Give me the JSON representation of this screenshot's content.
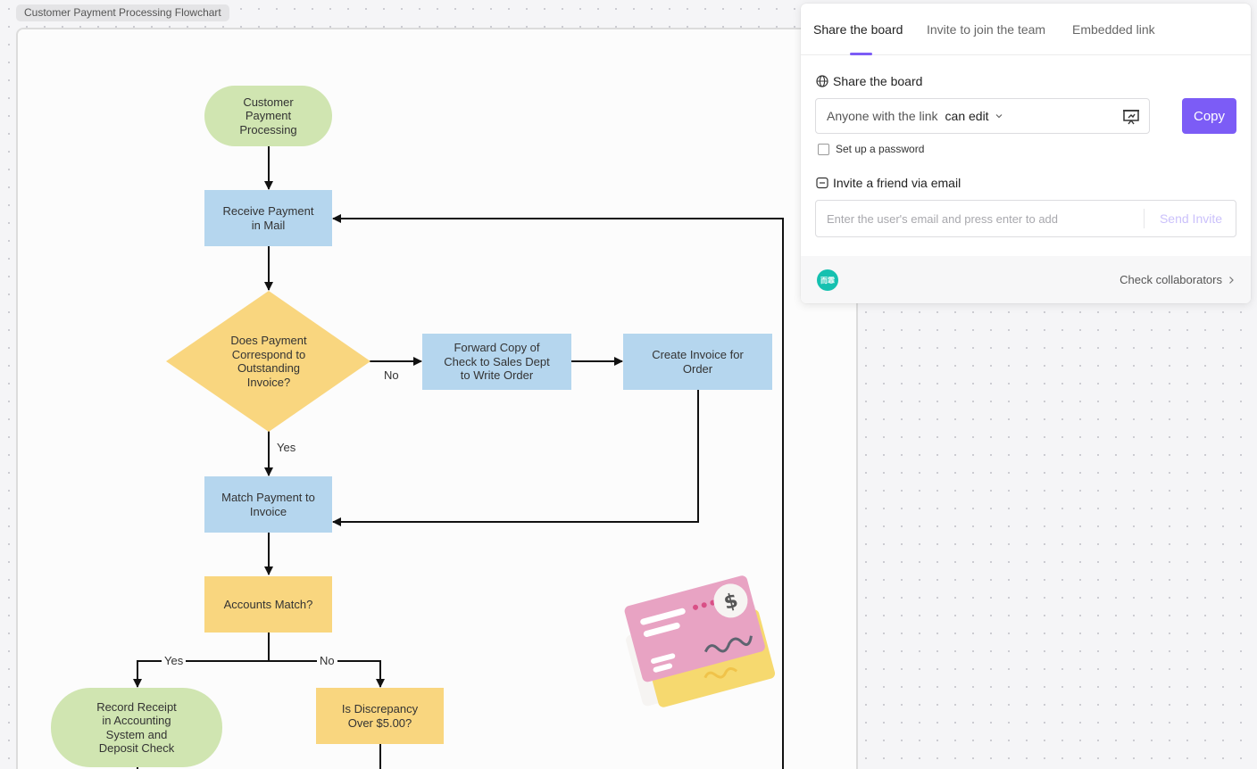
{
  "board": {
    "title": "Customer Payment Processing Flowchart"
  },
  "flowchart": {
    "nodes": {
      "start": "Customer\nPayment\nProcessing",
      "receive": "Receive Payment\nin Mail",
      "decision_invoice": "Does Payment\nCorrespond to\nOutstanding\nInvoice?",
      "forward": "Forward Copy of\nCheck to Sales Dept\nto Write Order",
      "create_invoice": "Create Invoice for\nOrder",
      "match": "Match Payment to\nInvoice",
      "accounts_match": "Accounts Match?",
      "record": "Record Receipt\nin Accounting\nSystem and\nDeposit Check",
      "discrepancy": "Is Discrepancy\nOver $5.00?"
    },
    "labels": {
      "no_1": "No",
      "yes_1": "Yes",
      "yes_2": "Yes",
      "no_2": "No"
    },
    "colors": {
      "process": "#b5d6ee",
      "decision": "#f9d67f",
      "terminal": "#d0e5b1"
    }
  },
  "share_panel": {
    "tabs": [
      {
        "label": "Share the board",
        "active": true
      },
      {
        "label": "Invite to join the team",
        "active": false
      },
      {
        "label": "Embedded link",
        "active": false
      }
    ],
    "share_section_title": "Share the board",
    "link_text": "Anyone with the link",
    "permission": "can edit",
    "copy_label": "Copy",
    "password_label": "Set up a password",
    "invite_section_title": "Invite a friend via email",
    "email_placeholder": "Enter the user's email and press enter to add",
    "send_label": "Send Invite",
    "avatar_initials": "而霏",
    "collaborators_label": "Check collaborators",
    "accent_color": "#7c5cf6"
  }
}
